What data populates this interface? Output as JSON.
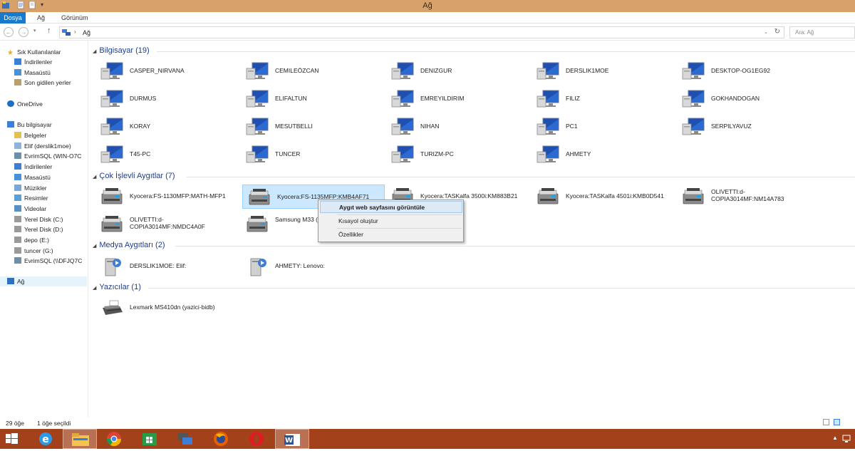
{
  "window": {
    "title": "Ağ"
  },
  "ribbon": {
    "tabs": [
      "Dosya",
      "Ağ",
      "Görünüm"
    ]
  },
  "address": {
    "crumb": "Ağ",
    "search_placeholder": "Ara: Ağ"
  },
  "nav": {
    "favorites": [
      "Sık Kullanılanlar",
      "İndirilenler",
      "Masaüstü",
      "Son gidilen yerler"
    ],
    "onedrive": "OneDrive",
    "thispc": "Bu bilgisayar",
    "thispc_items": [
      "Belgeler",
      "Elif (derslik1moe)",
      "EvrimSQL (WIN-O7C",
      "İndirilenler",
      "Masaüstü",
      "Müzikler",
      "Resimler",
      "Videolar",
      "Yerel Disk (C:)",
      "Yerel Disk (D:)",
      "depo (E:)",
      "tuncer (G:)",
      "EvrimSQL (\\\\DFJQ7C"
    ],
    "network": "Ağ"
  },
  "groups": {
    "computers": {
      "header": "Bilgisayar (19)",
      "items": [
        "CASPER_NIRVANA",
        "CEMILEÖZCAN",
        "DENIZGUR",
        "DERSLIK1MOE",
        "DESKTOP-OG1EG92",
        "DURMUS",
        "ELIFALTUN",
        "EMREYILDIRIM",
        "FILIZ",
        "GOKHANDOGAN",
        "KORAY",
        "MESUTBELLI",
        "NIHAN",
        "PC1",
        "SERPILYAVUZ",
        "T45-PC",
        "TUNCER",
        "TURIZM-PC",
        "AHMETY"
      ]
    },
    "mfp": {
      "header": "Çok İşlevli Aygıtlar (7)",
      "items": [
        "Kyocera:FS-1130MFP:MATH-MFP1",
        "Kyocera:FS-1135MFP:KMB4AF71",
        "Kyocera:TASKalfa 3500i:KM883B21",
        "Kyocera:TASKalfa 4501i:KMB0D541",
        "OLIVETTI:d-COPIA3014MF:NM14A783",
        "OLIVETTI:d-COPIA3014MF:NMDC4A0F",
        "Samsung M33 (10.39.11.131)"
      ]
    },
    "media": {
      "header": "Medya Aygıtları (2)",
      "items": [
        "DERSLIK1MOE: Elif:",
        "AHMETY: Lenovo:"
      ]
    },
    "printers": {
      "header": "Yazıcılar (1)",
      "items": [
        "Lexmark MS410dn (yazici-bidb)"
      ]
    }
  },
  "context_menu": {
    "items": [
      "Aygıt web sayfasını görüntüle",
      "Kısayol oluştur",
      "Özellikler"
    ]
  },
  "status": {
    "count": "29 öğe",
    "selected": "1 öğe seçildi"
  },
  "colors": {
    "taskbar": "#a3421a",
    "titlebar": "#d6a16b",
    "accent": "#1979ca",
    "group_header": "#1e3d8a"
  }
}
